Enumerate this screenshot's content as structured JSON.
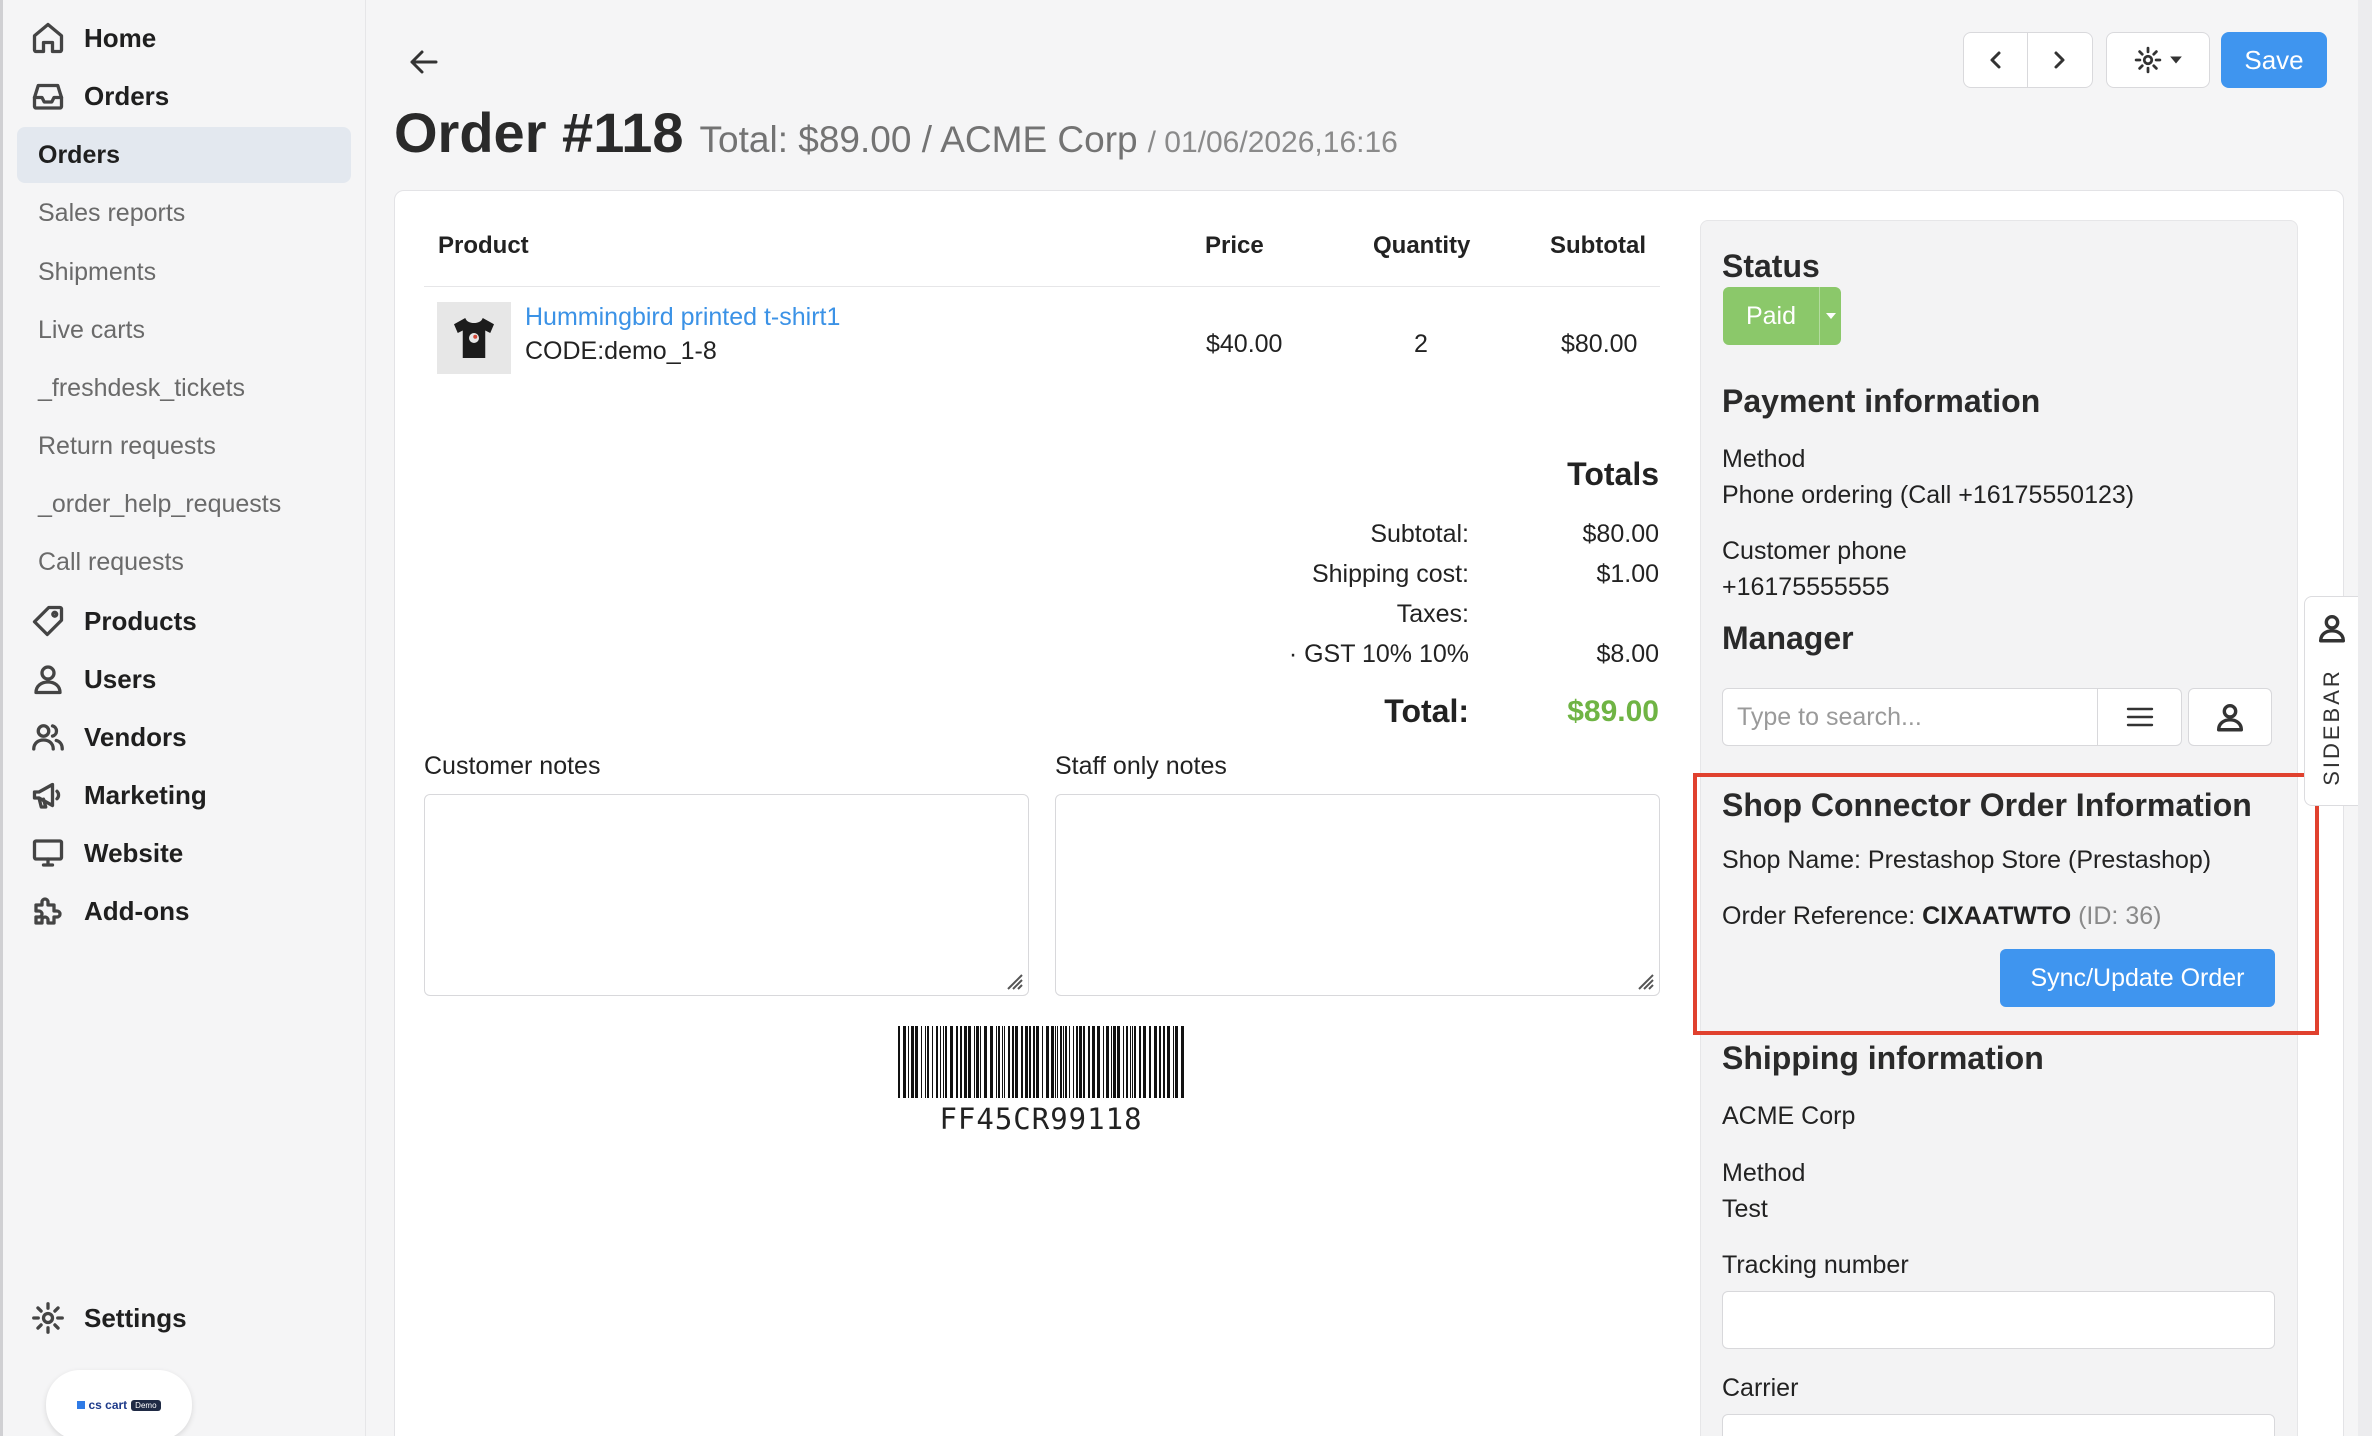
{
  "sidebar": {
    "top_items": [
      {
        "label": "Home",
        "icon": "home-icon"
      },
      {
        "label": "Orders",
        "icon": "inbox-icon"
      }
    ],
    "orders_submenu": [
      "Orders",
      "Sales reports",
      "Shipments",
      "Live carts",
      "_freshdesk_tickets",
      "Return requests",
      "_order_help_requests",
      "Call requests"
    ],
    "main_items": [
      {
        "label": "Products",
        "icon": "tag-icon"
      },
      {
        "label": "Users",
        "icon": "user-icon"
      },
      {
        "label": "Vendors",
        "icon": "users-icon"
      },
      {
        "label": "Marketing",
        "icon": "megaphone-icon"
      },
      {
        "label": "Website",
        "icon": "monitor-icon"
      },
      {
        "label": "Add-ons",
        "icon": "puzzle-icon"
      }
    ],
    "settings_label": "Settings",
    "brand": {
      "logo": "cs cart",
      "tag": "Demo"
    }
  },
  "header": {
    "title": "Order #118",
    "subtitle": "Total: $89.00 / ACME Corp",
    "date": "/ 01/06/2026,16:16",
    "save_label": "Save"
  },
  "products": {
    "columns": {
      "product": "Product",
      "price": "Price",
      "quantity": "Quantity",
      "subtotal": "Subtotal"
    },
    "rows": [
      {
        "name": "Hummingbird printed t-shirt1",
        "code": "CODE:demo_1-8",
        "price": "$40.00",
        "quantity": "2",
        "subtotal": "$80.00"
      }
    ]
  },
  "totals": {
    "title": "Totals",
    "subtotal_label": "Subtotal:",
    "subtotal": "$80.00",
    "shipping_label": "Shipping cost:",
    "shipping": "$1.00",
    "taxes_label": "Taxes:",
    "gst_label": "· GST 10% 10%",
    "gst": "$8.00",
    "total_label": "Total:",
    "total": "$89.00",
    "total_color": "#6fb444"
  },
  "notes": {
    "customer_label": "Customer notes",
    "staff_label": "Staff only notes"
  },
  "barcode": {
    "text": "FF45CR99118"
  },
  "panel": {
    "status_heading": "Status",
    "status_value": "Paid",
    "status_color": "#8bc86a",
    "payment_heading": "Payment information",
    "method_label": "Method",
    "method_value": "Phone ordering (Call +16175550123)",
    "phone_label": "Customer phone",
    "phone_value": "+16175555555",
    "manager_heading": "Manager",
    "manager_placeholder": "Type to search...",
    "shop_heading": "Shop Connector Order Information",
    "shop_name": "Shop Name: Prestashop Store (Prestashop)",
    "order_ref_label": "Order Reference:",
    "order_ref_value": "CIXAATWTO",
    "order_ref_id": "(ID: 36)",
    "sync_label": "Sync/Update Order",
    "shipping_heading": "Shipping information",
    "shipping_company": "ACME Corp",
    "shipping_method_label": "Method",
    "shipping_method_value": "Test",
    "tracking_label": "Tracking number",
    "carrier_label": "Carrier",
    "highlight_color": "#e0412e"
  },
  "sidebar_tab_label": "SIDEBAR",
  "accent_color": "#3f95ef"
}
